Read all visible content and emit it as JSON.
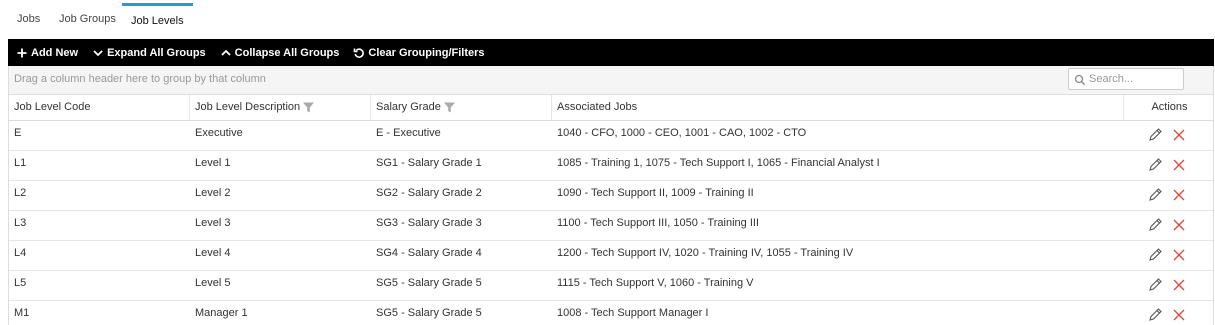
{
  "tabs": [
    {
      "label": "Jobs"
    },
    {
      "label": "Job Groups"
    },
    {
      "label": "Job Levels"
    }
  ],
  "toolbar": {
    "add_new": "Add New",
    "expand_all": "Expand All Groups",
    "collapse_all": "Collapse All Groups",
    "clear": "Clear Grouping/Filters"
  },
  "group_panel": {
    "hint": "Drag a column header here to group by that column"
  },
  "search": {
    "placeholder": "Search..."
  },
  "columns": [
    {
      "label": "Job Level Code"
    },
    {
      "label": "Job Level Description"
    },
    {
      "label": "Salary Grade"
    },
    {
      "label": "Associated Jobs"
    },
    {
      "label": "Actions"
    }
  ],
  "rows": [
    {
      "code": "E",
      "description": "Executive",
      "salary_grade": "E - Executive",
      "jobs": "1040 - CFO, 1000 - CEO, 1001 - CAO, 1002 - CTO"
    },
    {
      "code": "L1",
      "description": "Level 1",
      "salary_grade": "SG1 - Salary Grade 1",
      "jobs": "1085 - Training 1, 1075 - Tech Support I, 1065 - Financial Analyst I"
    },
    {
      "code": "L2",
      "description": "Level 2",
      "salary_grade": "SG2 - Salary Grade 2",
      "jobs": "1090 - Tech Support II, 1009 - Training II"
    },
    {
      "code": "L3",
      "description": "Level 3",
      "salary_grade": "SG3 - Salary Grade 3",
      "jobs": "1100 - Tech Support III, 1050 - Training III"
    },
    {
      "code": "L4",
      "description": "Level 4",
      "salary_grade": "SG4 - Salary Grade 4",
      "jobs": "1200 - Tech Support IV, 1020 - Training IV, 1055 - Training IV"
    },
    {
      "code": "L5",
      "description": "Level 5",
      "salary_grade": "SG5 - Salary Grade 5",
      "jobs": "1115 - Tech Support V, 1060 - Training V"
    },
    {
      "code": "M1",
      "description": "Manager 1",
      "salary_grade": "SG5 - Salary Grade 5",
      "jobs": "1008 - Tech Support Manager I"
    }
  ],
  "colors": {
    "tab_accent": "#1aa3c7",
    "toolbar_bg": "#000000",
    "edit_icon": "#555555",
    "delete_icon": "#e0453a"
  },
  "icons": {
    "add": "plus-icon",
    "expand": "chevron-down-icon",
    "collapse": "chevron-up-icon",
    "clear": "undo-icon",
    "search": "search-icon",
    "filter": "filter-icon",
    "edit": "pencil-icon",
    "delete": "x-icon"
  }
}
